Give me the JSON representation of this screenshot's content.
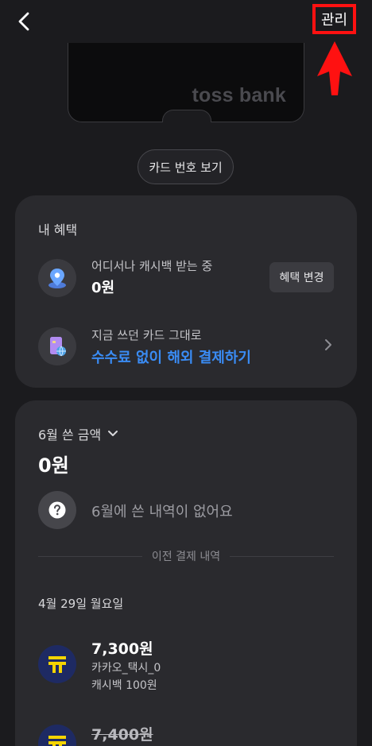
{
  "header": {
    "manage_label": "관리"
  },
  "card": {
    "brand": "toss bank"
  },
  "card_number_button": "카드 번호 보기",
  "benefits": {
    "title": "내 혜택",
    "cashback": {
      "subtitle": "어디서나 캐시백 받는 중",
      "amount": "0원",
      "change_label": "혜택 변경"
    },
    "overseas": {
      "subtitle": "지금 쓰던 카드 그대로",
      "link": "수수료 없이 해외 결제하기"
    }
  },
  "spending": {
    "month_label": "6월 쓴 금액",
    "amount": "0원",
    "empty_message": "6월에 쓴 내역이 없어요",
    "previous_label": "이전 결제 내역",
    "date_label": "4월 29일 월요일",
    "transactions": [
      {
        "amount": "7,300원",
        "merchant": "카카오_택시_0",
        "cashback": "캐시백 100원"
      },
      {
        "amount": "7,400원"
      }
    ]
  },
  "colors": {
    "background": "#1b1b1e",
    "panel": "#2a2a2e",
    "link_blue": "#3a8cf5",
    "highlight_red": "#ff1111",
    "taxi_yellow": "#f5d400"
  }
}
